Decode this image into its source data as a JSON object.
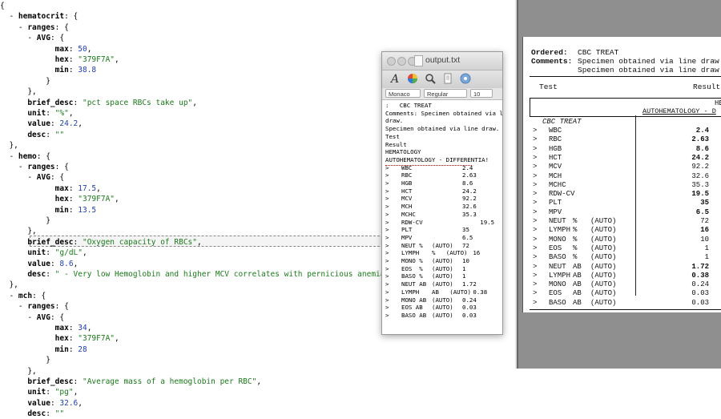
{
  "json_view": {
    "lines": [
      {
        "indent": 0,
        "parts": [
          {
            "t": "p",
            "v": "{"
          }
        ]
      },
      {
        "indent": 0,
        "parts": [
          {
            "t": "p",
            "v": "  - "
          },
          {
            "t": "k",
            "v": "hematocrit"
          },
          {
            "t": "p",
            "v": ": {"
          }
        ]
      },
      {
        "indent": 0,
        "parts": [
          {
            "t": "p",
            "v": "    - "
          },
          {
            "t": "k",
            "v": "ranges"
          },
          {
            "t": "p",
            "v": ": {"
          }
        ]
      },
      {
        "indent": 0,
        "parts": [
          {
            "t": "p",
            "v": "      - "
          },
          {
            "t": "k",
            "v": "AVG"
          },
          {
            "t": "p",
            "v": ": {"
          }
        ]
      },
      {
        "indent": 0,
        "parts": [
          {
            "t": "p",
            "v": "            "
          },
          {
            "t": "k",
            "v": "max"
          },
          {
            "t": "p",
            "v": ": "
          },
          {
            "t": "n",
            "v": "50"
          },
          {
            "t": "p",
            "v": ","
          }
        ]
      },
      {
        "indent": 0,
        "parts": [
          {
            "t": "p",
            "v": "            "
          },
          {
            "t": "k",
            "v": "hex"
          },
          {
            "t": "p",
            "v": ": "
          },
          {
            "t": "s",
            "v": "\"379F7A\""
          },
          {
            "t": "p",
            "v": ","
          }
        ]
      },
      {
        "indent": 0,
        "parts": [
          {
            "t": "p",
            "v": "            "
          },
          {
            "t": "k",
            "v": "min"
          },
          {
            "t": "p",
            "v": ": "
          },
          {
            "t": "n",
            "v": "38.8"
          }
        ]
      },
      {
        "indent": 0,
        "parts": [
          {
            "t": "p",
            "v": "          }"
          }
        ]
      },
      {
        "indent": 0,
        "parts": [
          {
            "t": "p",
            "v": "      },"
          }
        ]
      },
      {
        "indent": 0,
        "parts": [
          {
            "t": "p",
            "v": "      "
          },
          {
            "t": "k",
            "v": "brief_desc"
          },
          {
            "t": "p",
            "v": ": "
          },
          {
            "t": "s",
            "v": "\"pct space RBCs take up\""
          },
          {
            "t": "p",
            "v": ","
          }
        ]
      },
      {
        "indent": 0,
        "parts": [
          {
            "t": "p",
            "v": "      "
          },
          {
            "t": "k",
            "v": "unit"
          },
          {
            "t": "p",
            "v": ": "
          },
          {
            "t": "s",
            "v": "\"%\""
          },
          {
            "t": "p",
            "v": ","
          }
        ]
      },
      {
        "indent": 0,
        "parts": [
          {
            "t": "p",
            "v": "      "
          },
          {
            "t": "k",
            "v": "value"
          },
          {
            "t": "p",
            "v": ": "
          },
          {
            "t": "n",
            "v": "24.2"
          },
          {
            "t": "p",
            "v": ","
          }
        ]
      },
      {
        "indent": 0,
        "parts": [
          {
            "t": "p",
            "v": "      "
          },
          {
            "t": "k",
            "v": "desc"
          },
          {
            "t": "p",
            "v": ": "
          },
          {
            "t": "s",
            "v": "\"\""
          }
        ]
      },
      {
        "indent": 0,
        "parts": [
          {
            "t": "p",
            "v": "  },"
          }
        ]
      },
      {
        "indent": 0,
        "parts": [
          {
            "t": "p",
            "v": "  - "
          },
          {
            "t": "k",
            "v": "hemo"
          },
          {
            "t": "p",
            "v": ": {"
          }
        ]
      },
      {
        "indent": 0,
        "parts": [
          {
            "t": "p",
            "v": "    - "
          },
          {
            "t": "k",
            "v": "ranges"
          },
          {
            "t": "p",
            "v": ": {"
          }
        ]
      },
      {
        "indent": 0,
        "parts": [
          {
            "t": "p",
            "v": "      - "
          },
          {
            "t": "k",
            "v": "AVG"
          },
          {
            "t": "p",
            "v": ": {"
          }
        ]
      },
      {
        "indent": 0,
        "parts": [
          {
            "t": "p",
            "v": "            "
          },
          {
            "t": "k",
            "v": "max"
          },
          {
            "t": "p",
            "v": ": "
          },
          {
            "t": "n",
            "v": "17.5"
          },
          {
            "t": "p",
            "v": ","
          }
        ]
      },
      {
        "indent": 0,
        "parts": [
          {
            "t": "p",
            "v": "            "
          },
          {
            "t": "k",
            "v": "hex"
          },
          {
            "t": "p",
            "v": ": "
          },
          {
            "t": "s",
            "v": "\"379F7A\""
          },
          {
            "t": "p",
            "v": ","
          }
        ]
      },
      {
        "indent": 0,
        "parts": [
          {
            "t": "p",
            "v": "            "
          },
          {
            "t": "k",
            "v": "min"
          },
          {
            "t": "p",
            "v": ": "
          },
          {
            "t": "n",
            "v": "13.5"
          }
        ]
      },
      {
        "indent": 0,
        "parts": [
          {
            "t": "p",
            "v": "          }"
          }
        ]
      },
      {
        "indent": 0,
        "parts": [
          {
            "t": "p",
            "v": "      },"
          }
        ]
      },
      {
        "indent": 0,
        "parts": [
          {
            "t": "p",
            "v": "      "
          },
          {
            "t": "k",
            "v": "brief_desc"
          },
          {
            "t": "p",
            "v": ": "
          },
          {
            "t": "s",
            "v": "\"Oxygen capacity of RBCs\""
          },
          {
            "t": "p",
            "v": ","
          }
        ]
      },
      {
        "indent": 0,
        "parts": [
          {
            "t": "p",
            "v": "      "
          },
          {
            "t": "k",
            "v": "unit"
          },
          {
            "t": "p",
            "v": ": "
          },
          {
            "t": "s",
            "v": "\"g/dL\""
          },
          {
            "t": "p",
            "v": ","
          }
        ]
      },
      {
        "indent": 0,
        "parts": [
          {
            "t": "p",
            "v": "      "
          },
          {
            "t": "k",
            "v": "value"
          },
          {
            "t": "p",
            "v": ": "
          },
          {
            "t": "n",
            "v": "8.6"
          },
          {
            "t": "p",
            "v": ","
          }
        ]
      },
      {
        "indent": 0,
        "parts": [
          {
            "t": "p",
            "v": "      "
          },
          {
            "t": "k",
            "v": "desc"
          },
          {
            "t": "p",
            "v": ": "
          },
          {
            "t": "s",
            "v": "\" - Very low Hemoglobin and higher MCV correlates with pernicious anemia\""
          }
        ]
      },
      {
        "indent": 0,
        "parts": [
          {
            "t": "p",
            "v": "  },"
          }
        ]
      },
      {
        "indent": 0,
        "parts": [
          {
            "t": "p",
            "v": "  - "
          },
          {
            "t": "k",
            "v": "mch"
          },
          {
            "t": "p",
            "v": ": {"
          }
        ]
      },
      {
        "indent": 0,
        "parts": [
          {
            "t": "p",
            "v": "    - "
          },
          {
            "t": "k",
            "v": "ranges"
          },
          {
            "t": "p",
            "v": ": {"
          }
        ]
      },
      {
        "indent": 0,
        "parts": [
          {
            "t": "p",
            "v": "      - "
          },
          {
            "t": "k",
            "v": "AVG"
          },
          {
            "t": "p",
            "v": ": {"
          }
        ]
      },
      {
        "indent": 0,
        "parts": [
          {
            "t": "p",
            "v": "            "
          },
          {
            "t": "k",
            "v": "max"
          },
          {
            "t": "p",
            "v": ": "
          },
          {
            "t": "n",
            "v": "34"
          },
          {
            "t": "p",
            "v": ","
          }
        ]
      },
      {
        "indent": 0,
        "parts": [
          {
            "t": "p",
            "v": "            "
          },
          {
            "t": "k",
            "v": "hex"
          },
          {
            "t": "p",
            "v": ": "
          },
          {
            "t": "s",
            "v": "\"379F7A\""
          },
          {
            "t": "p",
            "v": ","
          }
        ]
      },
      {
        "indent": 0,
        "parts": [
          {
            "t": "p",
            "v": "            "
          },
          {
            "t": "k",
            "v": "min"
          },
          {
            "t": "p",
            "v": ": "
          },
          {
            "t": "n",
            "v": "28"
          }
        ]
      },
      {
        "indent": 0,
        "parts": [
          {
            "t": "p",
            "v": "          }"
          }
        ]
      },
      {
        "indent": 0,
        "parts": [
          {
            "t": "p",
            "v": "      },"
          }
        ]
      },
      {
        "indent": 0,
        "parts": [
          {
            "t": "p",
            "v": "      "
          },
          {
            "t": "k",
            "v": "brief_desc"
          },
          {
            "t": "p",
            "v": ": "
          },
          {
            "t": "s",
            "v": "\"Average mass of a hemoglobin per RBC\""
          },
          {
            "t": "p",
            "v": ","
          }
        ]
      },
      {
        "indent": 0,
        "parts": [
          {
            "t": "p",
            "v": "      "
          },
          {
            "t": "k",
            "v": "unit"
          },
          {
            "t": "p",
            "v": ": "
          },
          {
            "t": "s",
            "v": "\"pg\""
          },
          {
            "t": "p",
            "v": ","
          }
        ]
      },
      {
        "indent": 0,
        "parts": [
          {
            "t": "p",
            "v": "      "
          },
          {
            "t": "k",
            "v": "value"
          },
          {
            "t": "p",
            "v": ": "
          },
          {
            "t": "n",
            "v": "32.6"
          },
          {
            "t": "p",
            "v": ","
          }
        ]
      },
      {
        "indent": 0,
        "parts": [
          {
            "t": "p",
            "v": "      "
          },
          {
            "t": "k",
            "v": "desc"
          },
          {
            "t": "p",
            "v": ": "
          },
          {
            "t": "s",
            "v": "\"\""
          }
        ]
      }
    ]
  },
  "textedit": {
    "title": "output.txt",
    "font_name": "Monaco",
    "font_style": "Regular",
    "font_size": "10",
    "lines_pre": [
      ":   CBC TREAT",
      "Comments: Specimen obtained via line",
      "draw.",
      "Specimen obtained via line draw.",
      "Test",
      "Result",
      "HEMATOLOGY",
      "AUTOHEMATOLOGY - DIFFERENTIA!"
    ],
    "rows": [
      [
        ">",
        "WBC",
        "",
        "2.4"
      ],
      [
        ">",
        "RBC",
        "",
        "2.63"
      ],
      [
        ">",
        "HGB",
        "",
        "8.6"
      ],
      [
        ">",
        "HCT",
        "",
        "24.2"
      ],
      [
        ">",
        "MCV",
        "",
        "92.2"
      ],
      [
        ">",
        "MCH",
        "",
        "32.6"
      ],
      [
        ">",
        "MCHC",
        "",
        "35.3"
      ],
      [
        ">",
        "RDW-CV",
        "",
        "     19.5"
      ],
      [
        ">",
        "PLT",
        "",
        "35"
      ],
      [
        ">",
        "MPV",
        "",
        "6.5"
      ],
      [
        ">",
        "NEUT %",
        "(AUTO)",
        "72"
      ],
      [
        ">",
        "LYMPH",
        "%   (AUTO)",
        "   16"
      ],
      [
        ">",
        "MONO %",
        "(AUTO)",
        "10"
      ],
      [
        ">",
        "EOS  %",
        "(AUTO)",
        "1"
      ],
      [
        ">",
        "BASO %",
        "(AUTO)",
        "1"
      ],
      [
        ">",
        "NEUT AB",
        "(AUTO)",
        "1.72"
      ],
      [
        ">",
        "LYMPH",
        "AB   (AUTO)",
        "   0.38"
      ],
      [
        ">",
        "MONO AB",
        "(AUTO)",
        "0.24"
      ],
      [
        ">",
        "EOS AB",
        "(AUTO)",
        "0.03"
      ],
      [
        ">",
        "BASO AB",
        "(AUTO)",
        "0.03"
      ]
    ]
  },
  "scan": {
    "ordered_label": "Ordered:",
    "ordered_value": "CBC TREAT",
    "comments_label": "Comments:",
    "comments_1": "Specimen obtained via line draw.",
    "comments_2": "Specimen obtained via line draw.",
    "test_header": "Test",
    "result_header": "Result",
    "box_line1": "HE",
    "box_line2": "AUTOHEMATOLOGY - D",
    "section": "CBC TREAT",
    "rows": [
      {
        "name": "WBC",
        "unit": "",
        "auto": "",
        "value": "2.4",
        "bold": true
      },
      {
        "name": "RBC",
        "unit": "",
        "auto": "",
        "value": "2.63",
        "bold": true
      },
      {
        "name": "HGB",
        "unit": "",
        "auto": "",
        "value": "8.6",
        "bold": true
      },
      {
        "name": "HCT",
        "unit": "",
        "auto": "",
        "value": "24.2",
        "bold": true
      },
      {
        "name": "MCV",
        "unit": "",
        "auto": "",
        "value": "92.2",
        "bold": false
      },
      {
        "name": "MCH",
        "unit": "",
        "auto": "",
        "value": "32.6",
        "bold": false
      },
      {
        "name": "MCHC",
        "unit": "",
        "auto": "",
        "value": "35.3",
        "bold": false
      },
      {
        "name": "RDW-CV",
        "unit": "",
        "auto": "",
        "value": "19.5",
        "bold": true
      },
      {
        "name": "PLT",
        "unit": "",
        "auto": "",
        "value": "35",
        "bold": true
      },
      {
        "name": "MPV",
        "unit": "",
        "auto": "",
        "value": "6.5",
        "bold": true
      },
      {
        "name": "NEUT",
        "unit": "%",
        "auto": "(AUTO)",
        "value": "72",
        "bold": false
      },
      {
        "name": "LYMPH",
        "unit": "%",
        "auto": "(AUTO)",
        "value": "16",
        "bold": true
      },
      {
        "name": "MONO",
        "unit": "%",
        "auto": "(AUTO)",
        "value": "10",
        "bold": false
      },
      {
        "name": "EOS",
        "unit": "%",
        "auto": "(AUTO)",
        "value": "1",
        "bold": false
      },
      {
        "name": "BASO",
        "unit": "%",
        "auto": "(AUTO)",
        "value": "1",
        "bold": false
      },
      {
        "name": "NEUT",
        "unit": "AB",
        "auto": "(AUTO)",
        "value": "1.72",
        "bold": true
      },
      {
        "name": "LYMPH",
        "unit": "AB",
        "auto": "(AUTO)",
        "value": "0.38",
        "bold": true
      },
      {
        "name": "MONO",
        "unit": "AB",
        "auto": "(AUTO)",
        "value": "0.24",
        "bold": false
      },
      {
        "name": "EOS",
        "unit": "AB",
        "auto": "(AUTO)",
        "value": "0.03",
        "bold": false
      },
      {
        "name": "BASO",
        "unit": "AB",
        "auto": "(AUTO)",
        "value": "0.03",
        "bold": false
      }
    ]
  },
  "colors": {
    "string": "#1a7a1a",
    "number": "#1f3fb0",
    "desktop_gray": "#8f8f8f"
  }
}
